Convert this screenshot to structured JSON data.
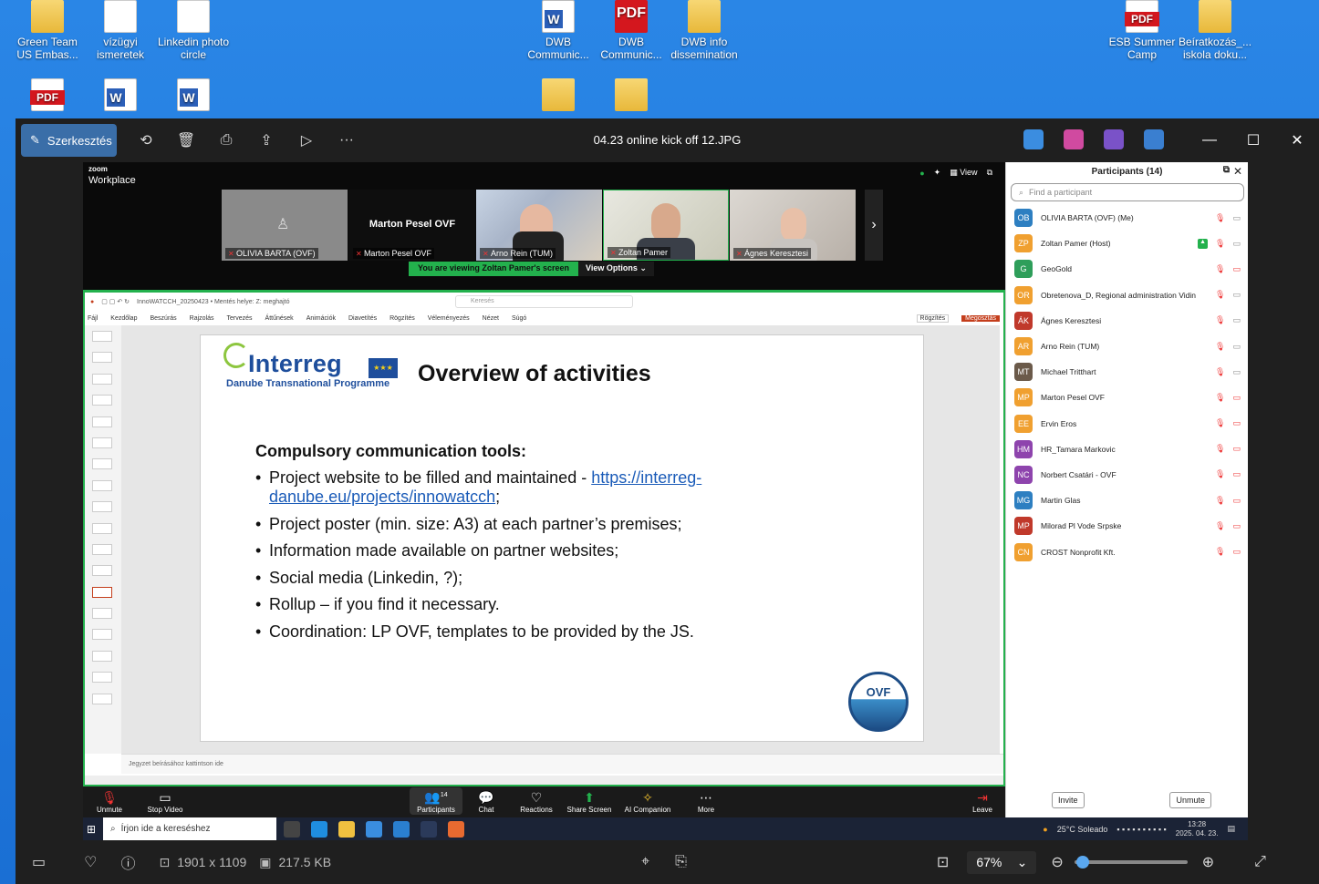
{
  "desktop": {
    "icons": [
      {
        "label": "Green Team US Embas...",
        "kind": "folder"
      },
      {
        "label": "vízügyi ismeretek",
        "kind": "doc"
      },
      {
        "label": "Linkedin photo circle",
        "kind": "doc"
      },
      {
        "label": "DWB Communic...",
        "kind": "word"
      },
      {
        "label": "DWB Communic...",
        "kind": "pdfbig"
      },
      {
        "label": "DWB info dissemination",
        "kind": "folder"
      },
      {
        "label": "ESB Summer Camp",
        "kind": "pdf"
      },
      {
        "label": "Beíratkozás_... iskola doku...",
        "kind": "folder"
      }
    ],
    "row2": [
      "pdf",
      "word",
      "word",
      "folder",
      "folder"
    ]
  },
  "viewer": {
    "edit_label": "Szerkesztés",
    "title": "04.23 online kick off 12.JPG",
    "status": {
      "dimensions": "1901 x 1109",
      "size": "217.5 KB",
      "zoom": "67%"
    }
  },
  "zoom": {
    "logo_top": "zoom",
    "logo_bottom": "Workplace",
    "view_label": "View",
    "tiles": [
      {
        "name": "OLIVIA BARTA (OVF)"
      },
      {
        "name": "Marton Pesel OVF",
        "big": "Marton Pesel OVF"
      },
      {
        "name": "Arno Rein (TUM)"
      },
      {
        "name": "Zoltan Pamer"
      },
      {
        "name": "Ágnes Keresztesi"
      }
    ],
    "viewing_text": "You are viewing  Zoltan Pamer's screen",
    "view_options": "View Options",
    "toolbar": [
      {
        "label": "Unmute",
        "icon": "mic-icon"
      },
      {
        "label": "Stop Video",
        "icon": "video-icon"
      },
      {
        "label": "Participants",
        "icon": "participants-icon",
        "badge": "14"
      },
      {
        "label": "Chat",
        "icon": "chat-icon"
      },
      {
        "label": "Reactions",
        "icon": "heart-icon"
      },
      {
        "label": "Share Screen",
        "icon": "share-screen-icon"
      },
      {
        "label": "AI Companion",
        "icon": "sparkle-icon"
      },
      {
        "label": "More",
        "icon": "more-icon"
      },
      {
        "label": "Leave",
        "icon": "leave-icon"
      }
    ]
  },
  "ppt": {
    "filename": "InnoWATCCH_20250423 • Mentés helye: Z: meghajtó",
    "search": "Keresés",
    "menu": [
      "Fájl",
      "Kezdőlap",
      "Beszúrás",
      "Rajzolás",
      "Tervezés",
      "Áttűnések",
      "Animációk",
      "Diavetítés",
      "Rögzítés",
      "Véleményezés",
      "Nézet",
      "Súgó"
    ],
    "record": "Rögzítés",
    "share": "Megosztás",
    "notes": "Jegyzet beírásához kattintson ide",
    "slide": {
      "logo_word": "Interreg",
      "logo_sub": "Danube Transnational Programme",
      "title": "Overview of activities",
      "heading": "Compulsory communication tools:",
      "bullet1_text": "Project website to be filled and maintained - ",
      "bullet1_link": "https://interreg-danube.eu/projects/innowatcch",
      "bullet1_end": ";",
      "bullets": [
        "Project poster (min. size: A3) at each partner’s premises;",
        "Information made available on partner websites;",
        "Social media (Linkedin, ?);",
        "Rollup – if you find it necessary.",
        "Coordination: LP OVF, templates to be provided by the JS."
      ],
      "ovf_logo": "OVF"
    }
  },
  "participants": {
    "title": "Participants (14)",
    "search_placeholder": "Find a participant",
    "list": [
      {
        "initials": "OB",
        "name": "OLIVIA BARTA (OVF) (Me)",
        "color": "#2d7fc1",
        "cam_off": false
      },
      {
        "initials": "ZP",
        "name": "Zoltan Pamer (Host)",
        "color": "#f0a030",
        "cam_off": false,
        "sharing": true
      },
      {
        "initials": "G",
        "name": "GeoGold",
        "color": "#2e9e5a",
        "cam_off": true
      },
      {
        "initials": "OR",
        "name": "Obretenova_D, Regional administration Vidin",
        "color": "#f0a030",
        "cam_off": false
      },
      {
        "initials": "ÁK",
        "name": "Ágnes Keresztesi",
        "color": "#c0392b",
        "cam_off": false
      },
      {
        "initials": "AR",
        "name": "Arno Rein (TUM)",
        "color": "#f0a030",
        "cam_off": false
      },
      {
        "initials": "MT",
        "name": "Michael Tritthart",
        "color": "#6b5a4a",
        "cam_off": false
      },
      {
        "initials": "MP",
        "name": "Marton Pesel OVF",
        "color": "#f0a030",
        "cam_off": true
      },
      {
        "initials": "EE",
        "name": "Ervin Eros",
        "color": "#f0a030",
        "cam_off": true
      },
      {
        "initials": "HM",
        "name": "HR_Tamara Markovic",
        "color": "#8e44ad",
        "cam_off": true
      },
      {
        "initials": "NC",
        "name": "Norbert Csatári - OVF",
        "color": "#8e44ad",
        "cam_off": true
      },
      {
        "initials": "MG",
        "name": "Martin Glas",
        "color": "#2d7fc1",
        "cam_off": true
      },
      {
        "initials": "MP",
        "name": "Milorad Pl Vode Srpske",
        "color": "#c0392b",
        "cam_off": true
      },
      {
        "initials": "CN",
        "name": "CROST Nonprofit Kft.",
        "color": "#f0a030",
        "cam_off": true
      }
    ],
    "invite": "Invite",
    "unmute": "Unmute"
  },
  "taskbar": {
    "search": "Írjon ide a kereséshez",
    "weather": "25°C  Soleado",
    "time": "13:28",
    "date": "2025. 04. 23."
  }
}
